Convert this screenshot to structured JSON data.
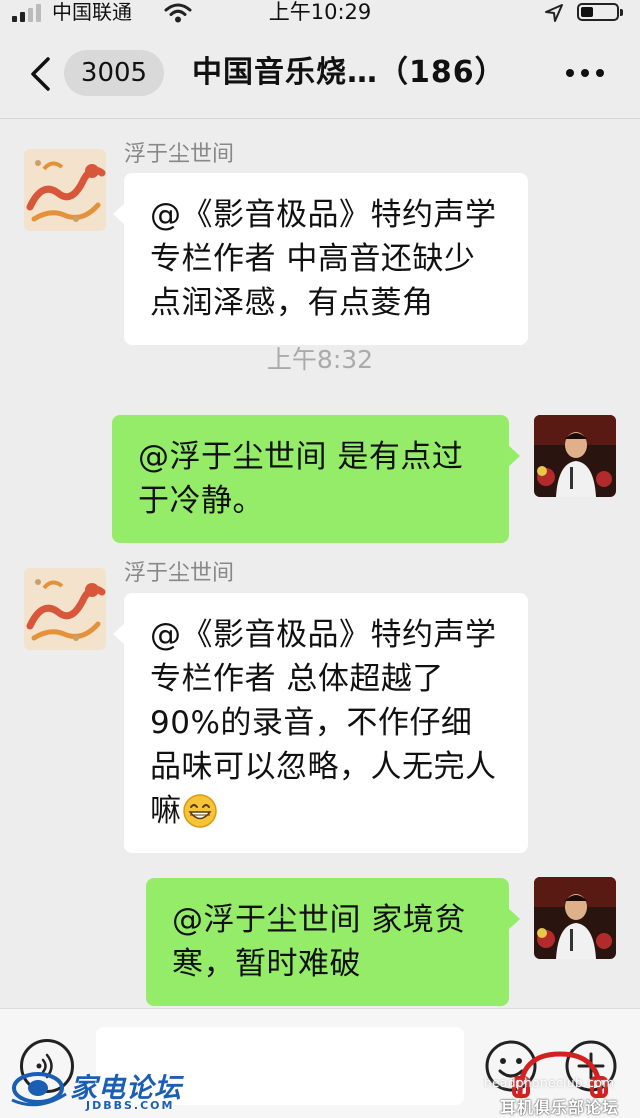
{
  "status_bar": {
    "carrier": "中国联通",
    "time": "上午10:29",
    "battery_level": 0.35
  },
  "nav": {
    "unread_count": "3005",
    "title": "中国音乐烧…（186）"
  },
  "messages": [
    {
      "direction": "in",
      "sender": "浮于尘世间",
      "text": "@《影音极品》特约声学专栏作者 中高音还缺少点润泽感，有点菱角"
    },
    {
      "direction": "timestamp",
      "text": "上午8:32"
    },
    {
      "direction": "out",
      "text": "@浮于尘世间 是有点过于冷静。"
    },
    {
      "direction": "in",
      "sender": "浮于尘世间",
      "text": "@《影音极品》特约声学专栏作者 总体超越了90%的录音，不作仔细品味可以忽略，人无完人嘛",
      "emoji": "grinning-face"
    },
    {
      "direction": "out",
      "text": "@浮于尘世间 家境贫寒，暂时难破"
    }
  ],
  "input_bar": {
    "placeholder": ""
  },
  "watermarks": {
    "left_title": "家电论坛",
    "left_sub": "JDBBS.COM",
    "right_url": "headphoneclub.com",
    "right_title": "耳机俱乐部论坛"
  },
  "colors": {
    "background": "#ededed",
    "bubble_out": "#95ec69",
    "bubble_in": "#ffffff"
  }
}
